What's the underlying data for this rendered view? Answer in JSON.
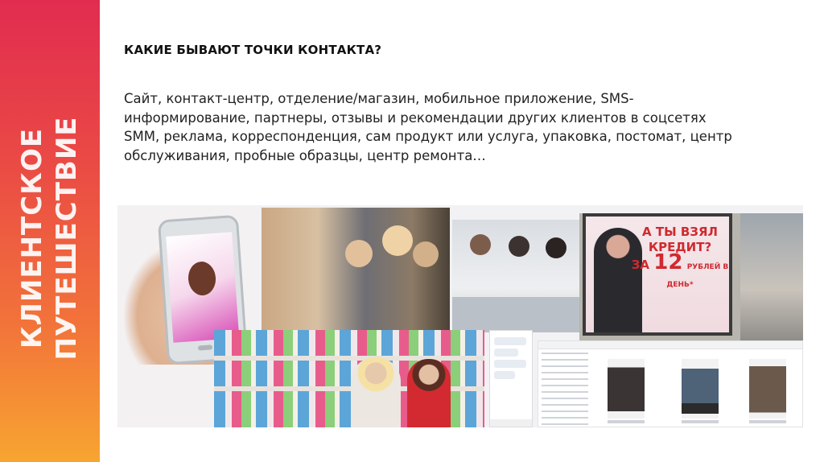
{
  "sidebar": {
    "title_line1": "КЛИЕНТСКОЕ",
    "title_line2": "ПУТЕШЕСТВИЕ",
    "gradient": [
      "#e12c50",
      "#f7a531"
    ]
  },
  "heading": "КАКИЕ БЫВАЮТ ТОЧКИ КОНТАКТА?",
  "body_lines": [
    "Сайт, контакт-центр, отделение/магазин, мобильное приложение, SMS-",
    "информирование, партнеры, отзывы и рекомендации других клиентов в соцсетях",
    "SMM, реклама, корреспонденция, сам продукт или услуга, упаковка, постомат, центр",
    "обслуживания, пробные образцы, центр ремонта…"
  ],
  "billboard": {
    "line1": "А ТЫ ВЗЯЛ",
    "line2": "КРЕДИТ?",
    "line3_prefix": "ЗА",
    "line3_number": "12",
    "line3_suffix": "РУБЛЕЙ В ДЕНЬ*"
  },
  "colors": {
    "billboard_red": "#d0292f"
  }
}
